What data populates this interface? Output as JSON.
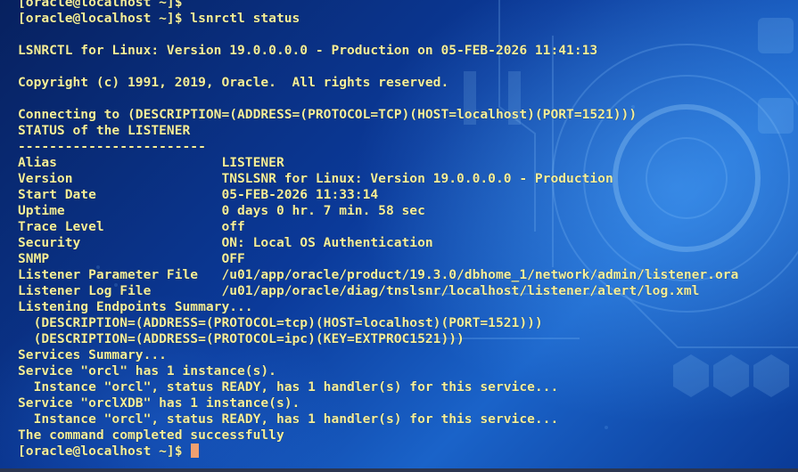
{
  "terminal": {
    "lines": [
      "[oracle@localhost ~]$",
      "[oracle@localhost ~]$ lsnrctl status",
      "",
      "LSNRCTL for Linux: Version 19.0.0.0.0 - Production on 05-FEB-2026 11:41:13",
      "",
      "Copyright (c) 1991, 2019, Oracle.  All rights reserved.",
      "",
      "Connecting to (DESCRIPTION=(ADDRESS=(PROTOCOL=TCP)(HOST=localhost)(PORT=1521)))",
      "STATUS of the LISTENER",
      "------------------------",
      "Alias                     LISTENER",
      "Version                   TNSLSNR for Linux: Version 19.0.0.0.0 - Production",
      "Start Date                05-FEB-2026 11:33:14",
      "Uptime                    0 days 0 hr. 7 min. 58 sec",
      "Trace Level               off",
      "Security                  ON: Local OS Authentication",
      "SNMP                      OFF",
      "Listener Parameter File   /u01/app/oracle/product/19.3.0/dbhome_1/network/admin/listener.ora",
      "Listener Log File         /u01/app/oracle/diag/tnslsnr/localhost/listener/alert/log.xml",
      "Listening Endpoints Summary...",
      "  (DESCRIPTION=(ADDRESS=(PROTOCOL=tcp)(HOST=localhost)(PORT=1521)))",
      "  (DESCRIPTION=(ADDRESS=(PROTOCOL=ipc)(KEY=EXTPROC1521)))",
      "Services Summary...",
      "Service \"orcl\" has 1 instance(s).",
      "  Instance \"orcl\", status READY, has 1 handler(s) for this service...",
      "Service \"orclXDB\" has 1 instance(s).",
      "  Instance \"orcl\", status READY, has 1 handler(s) for this service...",
      "The command completed successfully"
    ],
    "prompt": "[oracle@localhost ~]$ "
  },
  "colors": {
    "text": "#f5ef9a",
    "cursor": "#f0a070",
    "background": "#0b3a9a"
  }
}
